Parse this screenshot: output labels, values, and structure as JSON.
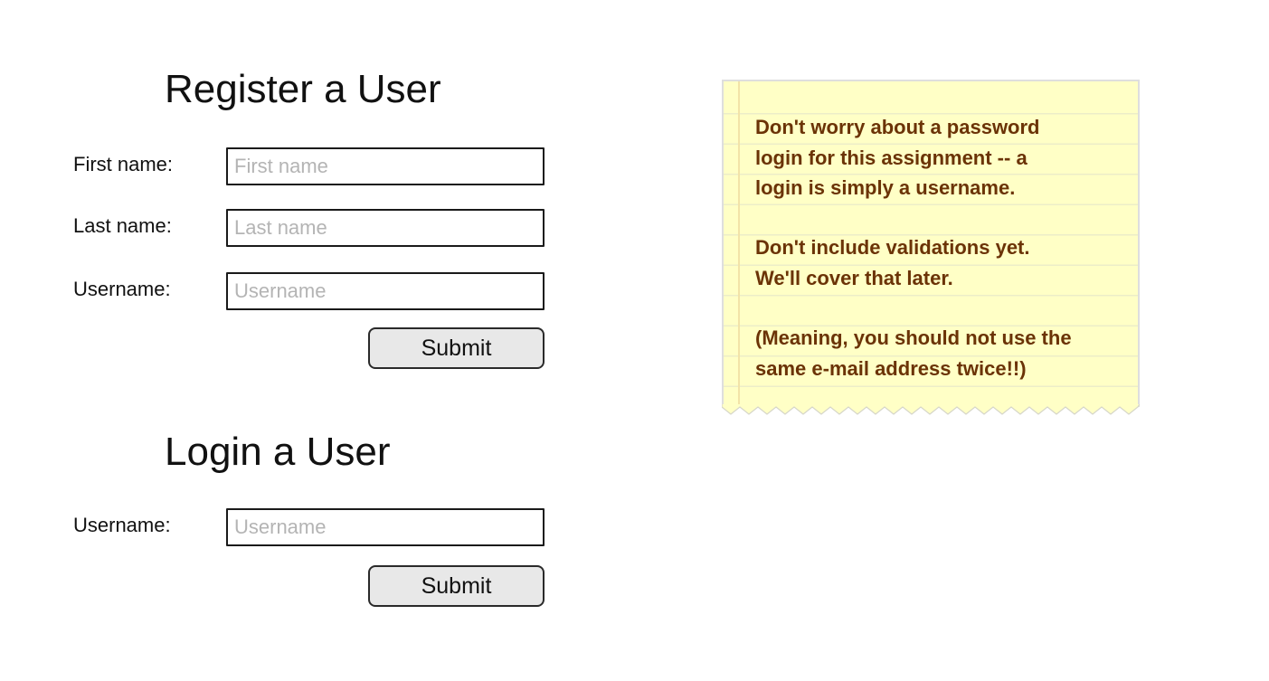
{
  "register": {
    "title": "Register a User",
    "fields": [
      {
        "label": "First name:",
        "placeholder": "First name",
        "value": ""
      },
      {
        "label": "Last name:",
        "placeholder": "Last name",
        "value": ""
      },
      {
        "label": "Username:",
        "placeholder": "Username",
        "value": ""
      }
    ],
    "submit_label": "Submit"
  },
  "login": {
    "title": "Login a User",
    "fields": [
      {
        "label": "Username:",
        "placeholder": "Username",
        "value": ""
      }
    ],
    "submit_label": "Submit"
  },
  "note": {
    "paragraphs": [
      "Don't worry about a password\nlogin for this assignment -- a\nlogin is simply a username.",
      "Don't include validations yet.\nWe'll cover that later.",
      "(Meaning, you should not use the\nsame e-mail address twice!!)"
    ],
    "colors": {
      "paper": "#ffffc6",
      "text": "#6b3306",
      "rule": "#ecedc8",
      "margin_line": "#f2e3a8"
    }
  }
}
